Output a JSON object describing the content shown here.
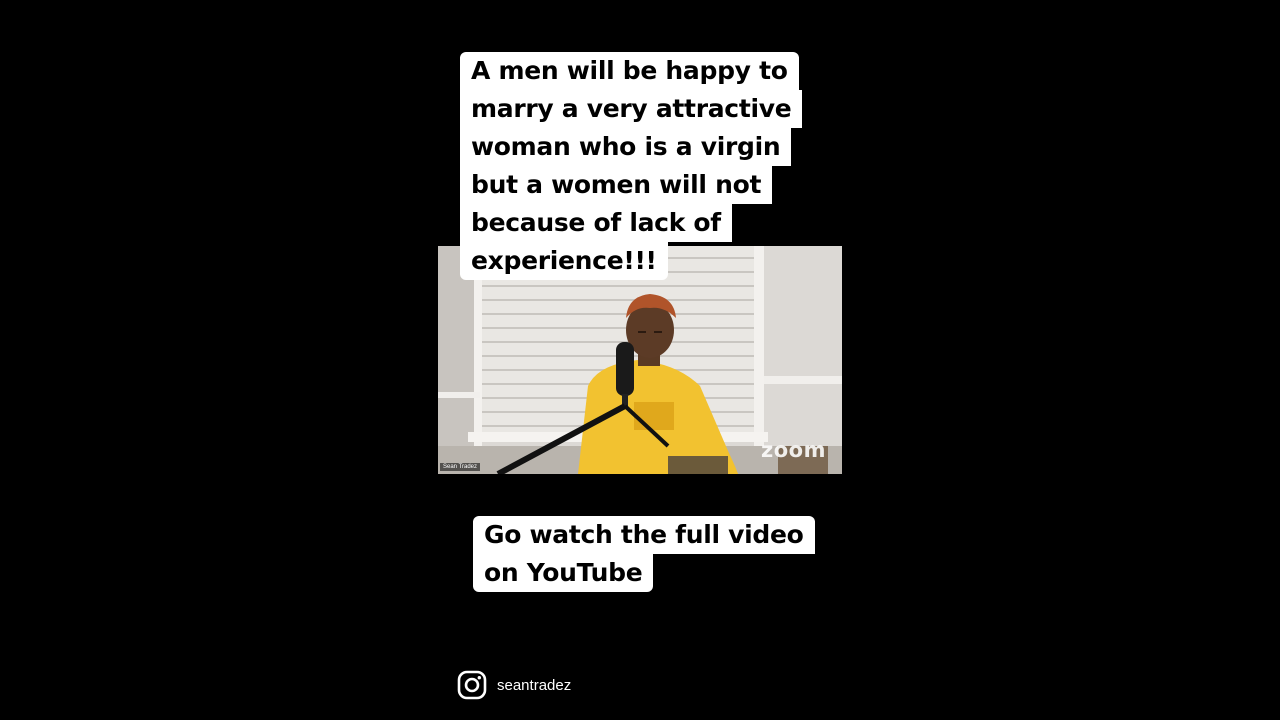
{
  "caption_top": {
    "lines": [
      "A men will be happy to",
      "marry a very attractive",
      "woman who is a virgin",
      "but a women will not",
      "because of lack of",
      "experience!!!"
    ]
  },
  "caption_bottom": {
    "lines": [
      "Go watch the full video",
      "on YouTube"
    ]
  },
  "video": {
    "participant_name": "Sean Tradez",
    "watermark": "zoom"
  },
  "footer": {
    "icon": "instagram-icon",
    "handle": "seantradez"
  },
  "colors": {
    "background": "#000000",
    "caption_box": "#ffffff",
    "caption_text": "#000000",
    "hoodie": "#f2c230"
  }
}
